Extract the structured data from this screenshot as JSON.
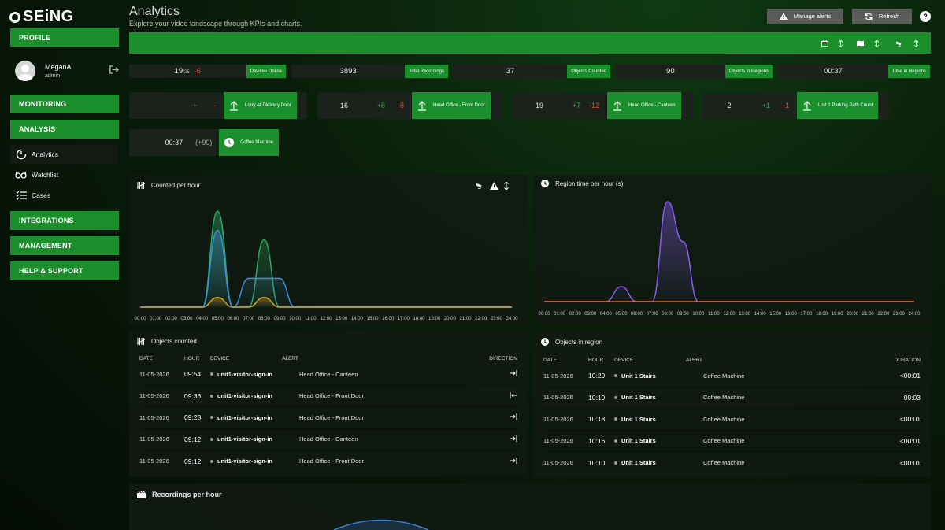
{
  "brand": {
    "logo": "SEiNG"
  },
  "sidebar": {
    "profile_label": "PROFILE",
    "user": {
      "name": "MeganA",
      "role": "admin"
    },
    "monitoring": "MONITORING",
    "analysis": "ANALYSIS",
    "analysis_items": [
      {
        "label": "Analytics",
        "icon": "analytics-icon",
        "active": true
      },
      {
        "label": "Watchlist",
        "icon": "glasses-icon",
        "active": false
      },
      {
        "label": "Cases",
        "icon": "checklist-icon",
        "active": false
      }
    ],
    "integrations": "INTEGRATIONS",
    "management": "MANAGEMENT",
    "help": "HELP & SUPPORT"
  },
  "header": {
    "title": "Analytics",
    "subtitle": "Explore your video landscape through KPIs and charts.",
    "manage_alerts": "Manage alerts",
    "refresh": "Refresh",
    "help_icon": "?"
  },
  "kpis": [
    {
      "value": "19",
      "suffix": "/25",
      "delta": "-6",
      "label": "Devices Online"
    },
    {
      "value": "3893",
      "suffix": "",
      "delta": "",
      "label": "Total Recordings"
    },
    {
      "value": "37",
      "suffix": "",
      "delta": "",
      "label": "Objects Counted"
    },
    {
      "value": "90",
      "suffix": "",
      "delta": "",
      "label": "Objects in Regions"
    },
    {
      "value": "00:37",
      "suffix": "",
      "delta": "",
      "label": "Time in Regions"
    }
  ],
  "counters": [
    {
      "value": "",
      "plus": "+",
      "minus": "-",
      "label": "Lorry At Dleivery Door"
    },
    {
      "value": "16",
      "plus": "+8",
      "minus": "-8",
      "label": "Head Office - Front Door"
    },
    {
      "value": "19",
      "plus": "+7",
      "minus": "-12",
      "label": "Head Office - Canteen"
    },
    {
      "value": "2",
      "plus": "+1",
      "minus": "-1",
      "label": "Unit 1 Parking Path Count"
    }
  ],
  "timer": {
    "value": "00:37",
    "extra": "(+90)",
    "label": "Coffee Machine"
  },
  "panels": {
    "counted_title": "Counted per hour",
    "region_title": "Region time per hour (s)",
    "objects_counted_title": "Objects counted",
    "objects_region_title": "Objects in region",
    "recordings_title": "Recordings per hour"
  },
  "hours": [
    "00:00",
    "01:00",
    "02:00",
    "03:00",
    "04:00",
    "05:00",
    "06:00",
    "07:00",
    "08:00",
    "09:00",
    "10:00",
    "11:00",
    "12:00",
    "13:00",
    "14:00",
    "15:00",
    "16:00",
    "17:00",
    "18:00",
    "19:00",
    "20:00",
    "21:00",
    "22:00",
    "23:00",
    "24:00"
  ],
  "chart_data": [
    {
      "type": "area",
      "title": "Counted per hour",
      "x": [
        "00:00",
        "01:00",
        "02:00",
        "03:00",
        "04:00",
        "05:00",
        "06:00",
        "07:00",
        "08:00",
        "09:00",
        "10:00",
        "11:00",
        "12:00",
        "13:00",
        "14:00",
        "15:00",
        "16:00",
        "17:00",
        "18:00",
        "19:00",
        "20:00",
        "21:00",
        "22:00",
        "23:00",
        "24:00"
      ],
      "series": [
        {
          "color": "#2fa866",
          "values": [
            0,
            0,
            0,
            0,
            0,
            10,
            0,
            0,
            7,
            0,
            0,
            0,
            0,
            0,
            0,
            0,
            0,
            0,
            0,
            0,
            0,
            0,
            0,
            0,
            0
          ]
        },
        {
          "color": "#3c8fd0",
          "values": [
            0,
            0,
            0,
            0,
            0,
            8,
            0,
            3,
            3,
            3,
            0,
            0,
            0,
            0,
            0,
            0,
            0,
            0,
            0,
            0,
            0,
            0,
            0,
            0,
            0
          ]
        },
        {
          "color": "#d4a020",
          "values": [
            0,
            0,
            0,
            0,
            0,
            1,
            0,
            0,
            1,
            0,
            0,
            0,
            0,
            0,
            0,
            0,
            0,
            0,
            0,
            0,
            0,
            0,
            0,
            0,
            0
          ]
        }
      ],
      "grid": false
    },
    {
      "type": "area",
      "title": "Region time per hour (s)",
      "x": [
        "00:00",
        "01:00",
        "02:00",
        "03:00",
        "04:00",
        "05:00",
        "06:00",
        "07:00",
        "08:00",
        "09:00",
        "10:00",
        "11:00",
        "12:00",
        "13:00",
        "14:00",
        "15:00",
        "16:00",
        "17:00",
        "18:00",
        "19:00",
        "20:00",
        "21:00",
        "22:00",
        "23:00",
        "24:00"
      ],
      "series": [
        {
          "color": "#8a5cf0",
          "values": [
            0,
            0,
            0,
            0,
            0,
            1.5,
            0,
            0,
            10,
            6,
            0,
            0,
            0,
            0,
            0,
            0,
            0,
            0,
            0,
            0,
            0,
            0,
            0,
            0,
            0
          ]
        },
        {
          "color": "#e06a2a",
          "values": [
            0,
            0,
            0,
            0,
            0,
            0,
            0,
            0,
            0,
            0,
            0,
            0,
            0,
            0,
            0,
            0,
            0,
            0,
            0,
            0,
            0,
            0,
            0,
            0,
            0
          ]
        }
      ],
      "grid": false
    }
  ],
  "objects_counted": {
    "headers": [
      "DATE",
      "HOUR",
      "DEVICE",
      "ALERT",
      "DIRECTION"
    ],
    "rows": [
      {
        "date": "11-05-2026",
        "hour": "09:54",
        "device": "unit1-visitor-sign-in",
        "alert": "Head Office - Canteen",
        "dir": "in"
      },
      {
        "date": "11-05-2026",
        "hour": "09:36",
        "device": "unit1-visitor-sign-in",
        "alert": "Head Office - Front Door",
        "dir": "out"
      },
      {
        "date": "11-05-2026",
        "hour": "09:28",
        "device": "unit1-visitor-sign-in",
        "alert": "Head Office - Front Door",
        "dir": "in"
      },
      {
        "date": "11-05-2026",
        "hour": "09:12",
        "device": "unit1-visitor-sign-in",
        "alert": "Head Office - Canteen",
        "dir": "in"
      },
      {
        "date": "11-05-2026",
        "hour": "09:12",
        "device": "unit1-visitor-sign-in",
        "alert": "Head Office - Front Door",
        "dir": "in"
      }
    ]
  },
  "objects_region": {
    "headers": [
      "DATE",
      "HOUR",
      "DEVICE",
      "ALERT",
      "DURATION"
    ],
    "rows": [
      {
        "date": "11-05-2026",
        "hour": "10:29",
        "device": "Unit 1 Stairs",
        "alert": "Coffee Machine",
        "duration": "<00:01"
      },
      {
        "date": "11-05-2026",
        "hour": "10:19",
        "device": "Unit 1 Stairs",
        "alert": "Coffee Machine",
        "duration": "00:03"
      },
      {
        "date": "11-05-2026",
        "hour": "10:18",
        "device": "Unit 1 Stairs",
        "alert": "Coffee Machine",
        "duration": "<00:01"
      },
      {
        "date": "11-05-2026",
        "hour": "10:16",
        "device": "Unit 1 Stairs",
        "alert": "Coffee Machine",
        "duration": "<00:01"
      },
      {
        "date": "11-05-2026",
        "hour": "10:10",
        "device": "Unit 1 Stairs",
        "alert": "Coffee Machine",
        "duration": "<00:01"
      }
    ]
  },
  "colors": {
    "brand_green": "#1a8f2c",
    "negative": "#e04a3a",
    "positive": "#2faa42"
  }
}
